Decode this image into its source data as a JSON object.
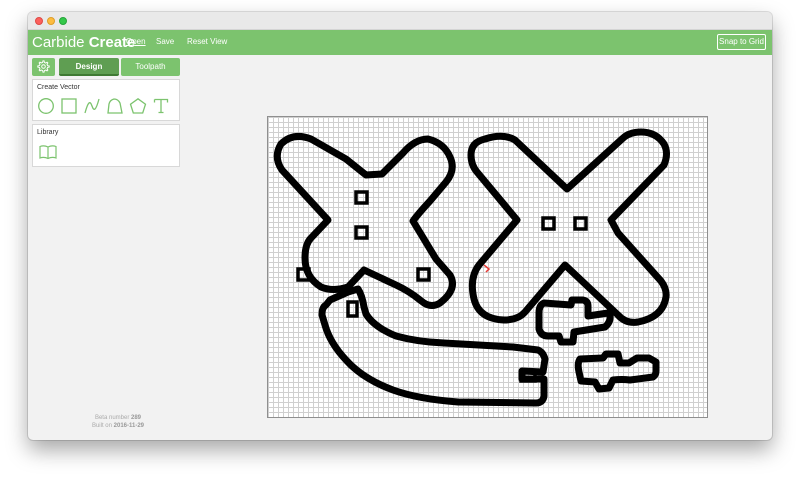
{
  "window": {
    "traffic_lights": [
      "close",
      "minimize",
      "maximize"
    ]
  },
  "toolbar": {
    "app_name_light": "Carbide ",
    "app_name_bold": "Create",
    "menu": {
      "open": "Open",
      "save": "Save",
      "reset_view": "Reset View"
    },
    "snap_to_grid": "Snap to Grid"
  },
  "sidebar": {
    "settings_icon": "gear-icon",
    "tabs": {
      "design": "Design",
      "toolpath": "Toolpath"
    },
    "create_vector": {
      "title": "Create Vector",
      "tools": [
        "circle-icon",
        "rectangle-icon",
        "curve-icon",
        "polyline-icon",
        "polygon-icon",
        "text-icon"
      ]
    },
    "library": {
      "title": "Library",
      "icon": "book-icon"
    }
  },
  "build": {
    "beta_label": "Beta number ",
    "beta_number": "289",
    "built_label": "Built on ",
    "built_date": "2016-11-29"
  },
  "colors": {
    "toolbar_green": "#7cc36e",
    "active_tab_green": "#5f9e52",
    "vector_stroke": "#000000",
    "origin_marker": "#e53935"
  }
}
